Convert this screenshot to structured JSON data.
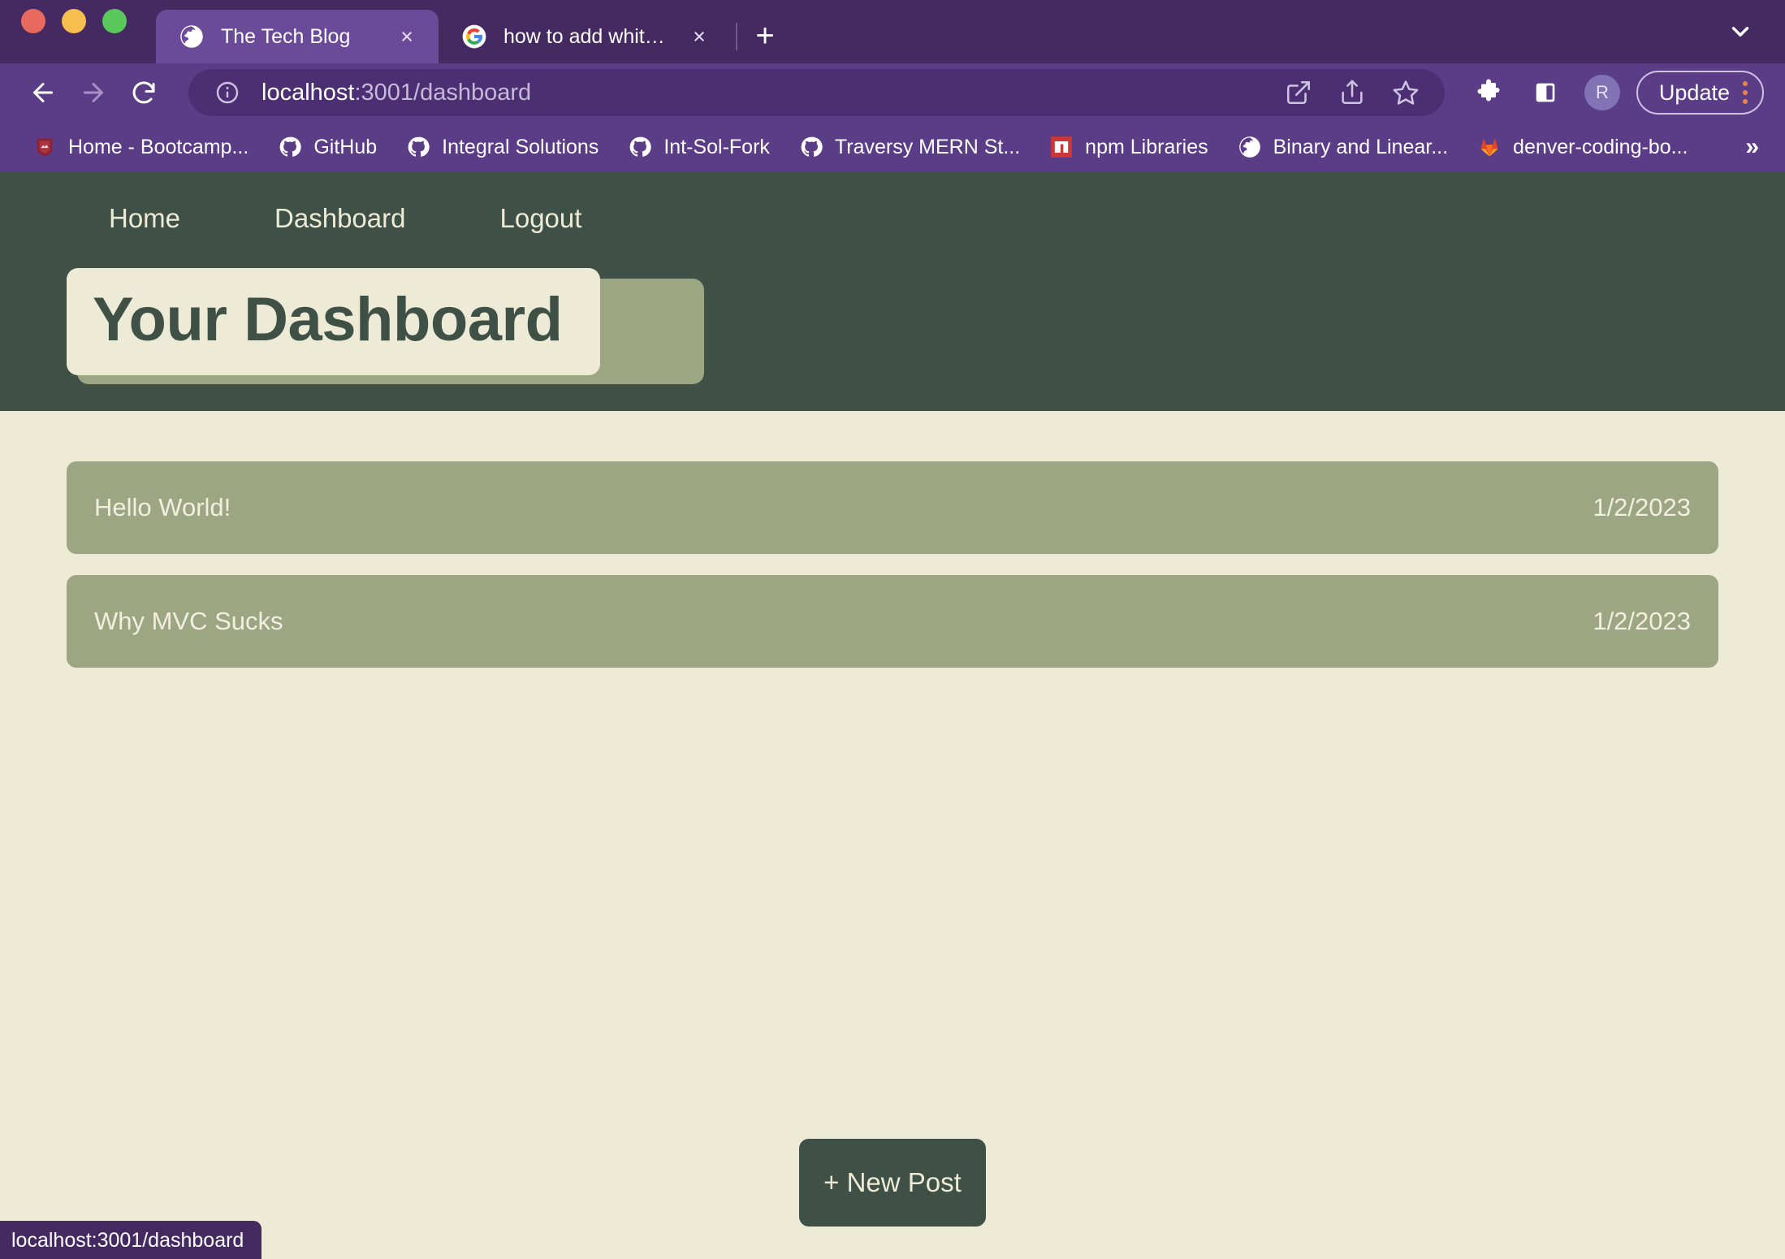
{
  "browser": {
    "window_controls": [
      "close",
      "minimize",
      "maximize"
    ],
    "tabs": [
      {
        "title": "The Tech Blog",
        "favicon": "globe-icon",
        "active": true,
        "close_label": "×"
      },
      {
        "title": "how to add white space html -",
        "favicon": "google-icon",
        "active": false,
        "close_label": "×"
      }
    ],
    "new_tab_label": "+",
    "tab_list_chevron": "chevron-down-icon",
    "toolbar": {
      "back_label": "←",
      "forward_label": "→",
      "reload_label": "⟳",
      "site_info_icon": "info-circle-icon",
      "url_host": "localhost",
      "url_path": ":3001/dashboard",
      "omnibox_actions": [
        "open-in-new-icon",
        "share-icon",
        "star-icon"
      ],
      "extensions_icon": "puzzle-icon",
      "side_panel_icon": "side-panel-icon",
      "profile_initial": "R",
      "update_label": "Update",
      "menu_icon": "kebab-menu-icon"
    },
    "bookmarks": [
      {
        "label": "Home - Bootcamp...",
        "icon": "crest-icon"
      },
      {
        "label": "GitHub",
        "icon": "github-icon"
      },
      {
        "label": "Integral Solutions",
        "icon": "github-icon"
      },
      {
        "label": "Int-Sol-Fork",
        "icon": "github-icon"
      },
      {
        "label": "Traversy MERN St...",
        "icon": "github-icon"
      },
      {
        "label": "npm Libraries",
        "icon": "npm-icon"
      },
      {
        "label": "Binary and Linear...",
        "icon": "globe-icon"
      },
      {
        "label": "denver-coding-bo...",
        "icon": "gitlab-icon"
      }
    ],
    "bookmarks_overflow_label": "»",
    "status_bar_text": "localhost:3001/dashboard"
  },
  "site": {
    "nav": [
      {
        "label": "Home"
      },
      {
        "label": "Dashboard"
      },
      {
        "label": "Logout"
      }
    ],
    "page_title": "Your Dashboard",
    "posts": [
      {
        "title": "Hello World!",
        "date": "1/2/2023"
      },
      {
        "title": "Why MVC Sucks",
        "date": "1/2/2023"
      }
    ],
    "new_post_label": "+ New Post"
  },
  "colors": {
    "chrome_tabstrip": "#452A62",
    "chrome_toolbar": "#5B3C87",
    "active_tab": "#6B4A99",
    "site_header_green": "#3F5047",
    "body_cream": "#EDEAD5",
    "card_sage": "#9CA683"
  }
}
